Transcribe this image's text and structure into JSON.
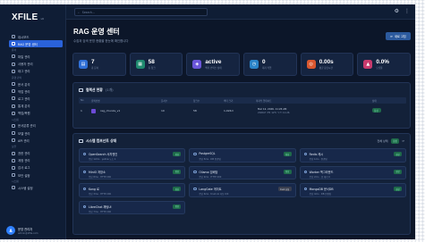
{
  "brand": {
    "name": "XFILE",
    "version": "v6"
  },
  "topbar": {
    "search_placeholder": "Search..."
  },
  "sidebar": {
    "items": [
      {
        "label": "대시보드",
        "active": false
      },
      {
        "label": "RAG 운영 센터",
        "active": true
      },
      {
        "section": "문서"
      },
      {
        "label": "파일 관리",
        "active": false
      },
      {
        "label": "사용자 관리",
        "active": false
      },
      {
        "label": "태그 관리",
        "active": false
      },
      {
        "section": "운영 관리"
      },
      {
        "label": "문서 분석",
        "active": false
      },
      {
        "label": "작업 관리",
        "active": false
      },
      {
        "label": "로그 관리",
        "active": false
      },
      {
        "label": "통계 분석",
        "active": false
      },
      {
        "label": "백업/복원",
        "active": false
      },
      {
        "section": "시스템"
      },
      {
        "label": "문서분류 관리",
        "active": false
      },
      {
        "label": "모델 관리",
        "active": false
      },
      {
        "label": "API 관리",
        "active": false
      },
      {
        "section": "보안"
      },
      {
        "label": "권한 관리",
        "active": false
      },
      {
        "label": "계정 관리",
        "active": false
      },
      {
        "label": "감사 로그",
        "active": false
      },
      {
        "label": "보안 설정",
        "active": false
      },
      {
        "section": "시스템"
      },
      {
        "label": "시스템 설정",
        "active": false
      }
    ],
    "user": {
      "initial": "A",
      "name": "운영 관리자",
      "email": "admin@xfile.com"
    }
  },
  "main": {
    "title": "RAG 운영 센터",
    "subtitle": "수집과 검색 운영 현황을 한눈에 확인합니다",
    "refresh_label": "새로 고침",
    "stats": [
      {
        "value": "7",
        "label": "총 문서",
        "icon": "document-icon",
        "color": "#2f6fd6",
        "glyph": "▤"
      },
      {
        "value": "58",
        "label": "총 청크",
        "icon": "chunk-icon",
        "color": "#1f8a6f",
        "glyph": "▦"
      },
      {
        "value": "active",
        "label": "벡터 인덱스 상태",
        "icon": "index-icon",
        "color": "#6b56d9",
        "glyph": "◈"
      },
      {
        "value": "0",
        "label": "대기 작업",
        "icon": "queue-icon",
        "color": "#2a84c9",
        "glyph": "◷"
      },
      {
        "value": "0.00s",
        "label": "평균 응답시간",
        "icon": "speed-icon",
        "color": "#d9572f",
        "glyph": "◎"
      },
      {
        "value": "0.0%",
        "label": "오류율",
        "icon": "error-icon",
        "color": "#c73a6d",
        "glyph": "▲"
      }
    ],
    "collections": {
      "title": "컬렉션 현황",
      "count": "(1개)",
      "headers": [
        "No",
        "컬렉션명",
        "문서수",
        "청크수",
        "벡터 크기",
        "마지막 업데이트",
        "",
        "상태"
      ],
      "rows": [
        {
          "no": "1",
          "name": "rag_chunks_v1",
          "docs": "10",
          "chunks": "58",
          "vector": "1,024d",
          "updated": "Mar 12, 2026, 11:26 AM",
          "updated_sub": "2026년 3월 12일 오전 11:26",
          "extra": "",
          "status": "정상"
        }
      ]
    },
    "services": {
      "title": "시스템 컴포넌트 상태",
      "summary": "전체 상태",
      "summary_badge": "정상",
      "items": [
        {
          "name": "OpenSearch 서치엔진",
          "meta": "응답 12ms · yellow 노드 1",
          "badge": "정상"
        },
        {
          "name": "PostgreSQL",
          "meta": "응답 5ms · DB 연결됨",
          "badge": "정상"
        },
        {
          "name": "Redis 캐시",
          "meta": "응답 1ms · 연결됨",
          "badge": "정상"
        },
        {
          "name": "MinIO 저장소",
          "meta": "응답 8ms · HTTP 200",
          "badge": "정상"
        },
        {
          "name": "Ollama 임베딩",
          "meta": "응답 9ms · HTTP 200",
          "badge": "정상"
        },
        {
          "name": "Worker 백그라운드",
          "meta": "응답 2ms · 큐 대기 0",
          "badge": "정상"
        },
        {
          "name": "Kong 로",
          "meta": "응답 3ms · HTTP 200",
          "badge": "정상"
        },
        {
          "name": "LangGate 게이트",
          "meta": "응답 6ms · trust·ok 자동 0/0",
          "badge": "trust 요청",
          "warn": true
        },
        {
          "name": "MongoDB 문서DB",
          "meta": "응답 4ms · DB 연결됨",
          "badge": "정상"
        },
        {
          "name": "LibreChat 채팅UI",
          "meta": "응답 7ms · HTTP 200",
          "badge": "정상"
        }
      ]
    }
  }
}
